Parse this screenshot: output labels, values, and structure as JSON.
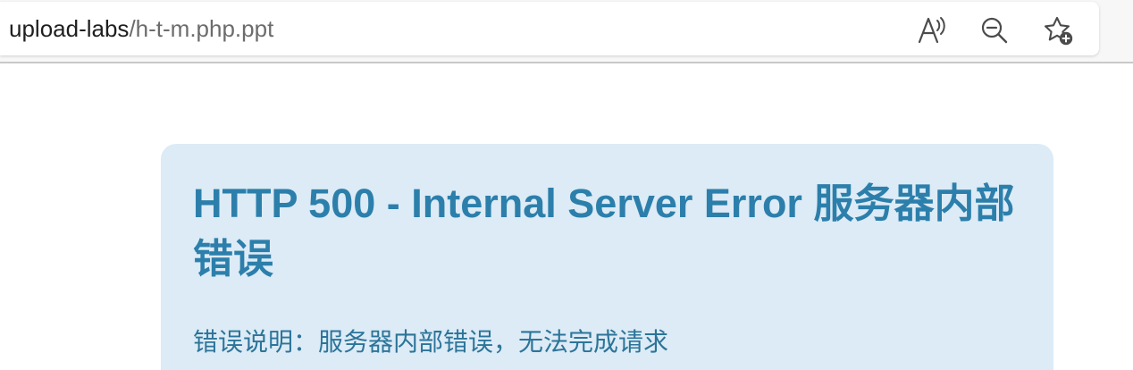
{
  "address_bar": {
    "url_host": "upload-labs",
    "url_path": "/h-t-m.php.ppt"
  },
  "toolbar": {
    "icons": [
      "read-aloud-icon",
      "zoom-out-icon",
      "favorite-star-add-icon"
    ]
  },
  "error_page": {
    "title": "HTTP 500 - Internal Server Error 服务器内部错误",
    "description": "错误说明：服务器内部错误，无法完成请求"
  },
  "colors": {
    "card_background": "#dcebf6",
    "title_color": "#2c7fab",
    "description_color": "#2c7499"
  }
}
